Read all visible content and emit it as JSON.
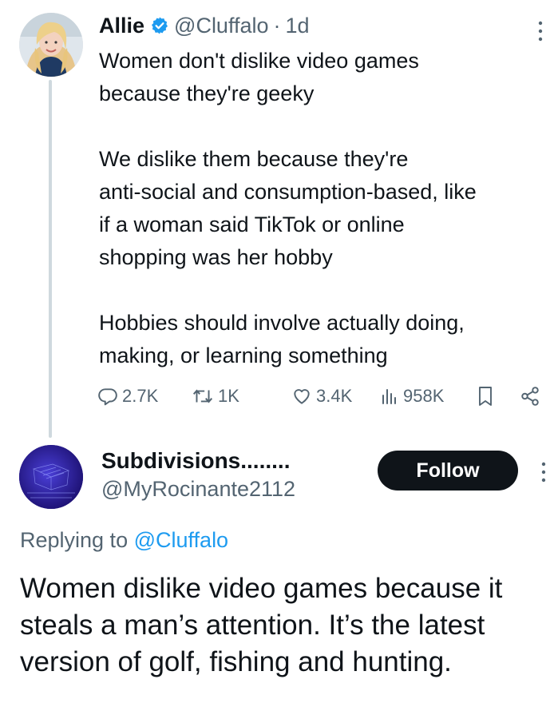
{
  "tweet": {
    "author_name": "Allie",
    "author_handle": "@Cluffalo",
    "separator": "·",
    "time": "1d",
    "lines": [
      "Women don't dislike video games",
      "because they're geeky",
      "",
      "We dislike them because they're",
      "anti-social and consumption-based, like",
      "if a woman said TikTok or online",
      "shopping was her hobby",
      "",
      "Hobbies should involve actually doing,",
      "making, or learning something"
    ],
    "stats": {
      "replies": "2.7K",
      "retweets": "1K",
      "likes": "3.4K",
      "views": "958K"
    },
    "icons": [
      "verified-badge-icon",
      "more-icon",
      "reply-icon",
      "retweet-icon",
      "like-icon",
      "views-icon",
      "bookmark-icon",
      "share-icon"
    ]
  },
  "reply": {
    "author_name": "Subdivisions........",
    "author_handle": "@MyRocinante2112",
    "follow_label": "Follow",
    "replying_prefix": "Replying to",
    "replying_mention": "@Cluffalo",
    "lines": [
      "Women dislike video games because it",
      "steals a man’s attention. It’s the latest",
      "version of golf, fishing and hunting."
    ]
  },
  "colors": {
    "text": "#0f1419",
    "secondary": "#536471",
    "accent": "#1d9bf0",
    "thread_line": "#cfd9de",
    "follow_bg": "#0f1419"
  }
}
